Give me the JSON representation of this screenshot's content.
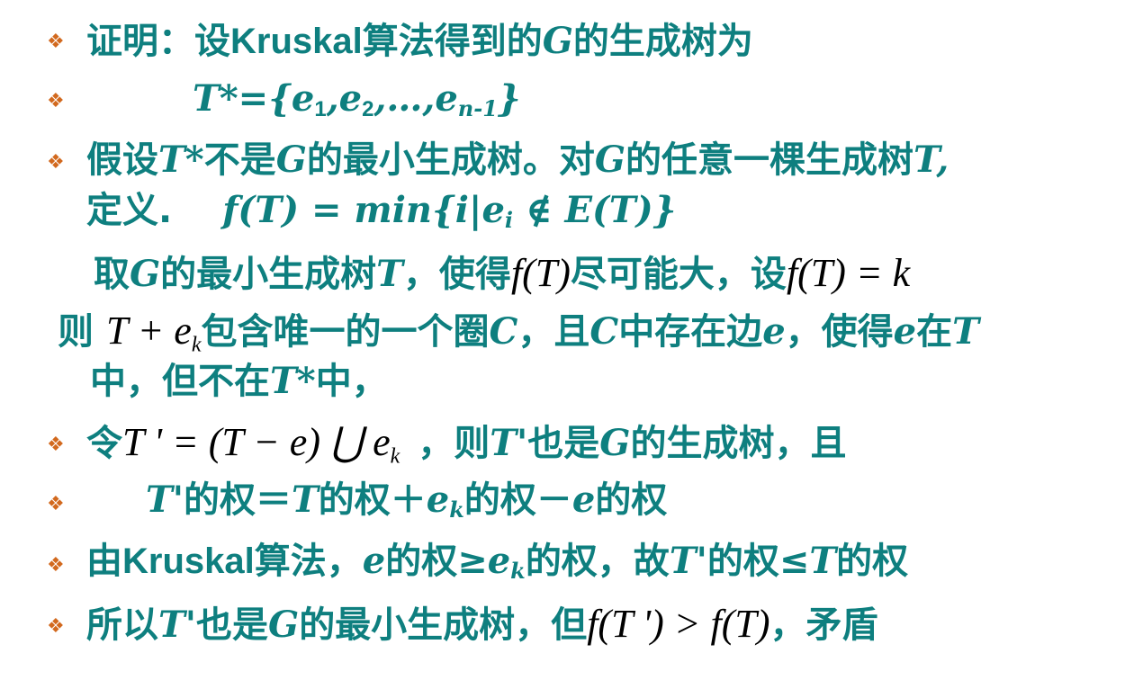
{
  "bullet_glyph": "❖",
  "colors": {
    "text": "#0e7f7f",
    "bullet": "#d2691e",
    "formula": "#000000"
  },
  "lines": {
    "l1": {
      "a": "证明：设",
      "b": "Kruskal",
      "c": "算法得到的",
      "d": "G",
      "e": "的生成树为"
    },
    "l2": {
      "a": "T*={",
      "b": "e",
      "b_sub": "1",
      "c": ",",
      "d": "e",
      "d_sub": "2",
      "e": ",…,",
      "f": "e",
      "f_sub": "n-1",
      "g": "}"
    },
    "l3": {
      "a": "假设",
      "b": "T*",
      "c": "不是",
      "d": "G",
      "e": "的最小生成树。对",
      "f": "G",
      "g": "的任意一棵生成树",
      "h": "T",
      "i": ","
    },
    "l4": {
      "a": "定义.",
      "b": "f(T) = min{i|e",
      "b_sub": "i",
      "c": " ∉ E(T)}"
    },
    "l5": {
      "a": "取",
      "b": "G",
      "c": "的最小生成树",
      "d": "T",
      "e": "，使得",
      "f": "f(T)",
      "g": "尽可能大，设",
      "h": "f(T) = k"
    },
    "l6": {
      "a": "则",
      "b": "T + e",
      "b_sub": "k",
      "c": "包含唯一的一个圈",
      "d": "C",
      "e": "，且",
      "f": "C",
      "g": "中存在边",
      "h": "e",
      "i": "，使得",
      "j": "e",
      "k": "在",
      "l": "T"
    },
    "l7": {
      "a": "中，但不在",
      "b": "T*",
      "c": "中，"
    },
    "l8": {
      "a": "令",
      "b": "T ' = (T − e) ⋃ e",
      "b_sub": "k",
      "c": "，则",
      "d": "T'",
      "e": "也是",
      "f": "G",
      "g": "的生成树，且"
    },
    "l9": {
      "a": "T'",
      "b": "的权＝",
      "c": "T",
      "d": "的权＋",
      "e": "e",
      "e_sub": "k",
      "f": "的权－",
      "g": "e",
      "h": "的权"
    },
    "l10": {
      "a": "由",
      "b": "Kruskal",
      "c": "算法，",
      "d": "e",
      "e": "的权≥",
      "f": "e",
      "f_sub": "k",
      "g": "的权，故",
      "h": "T'",
      "i": "的权≤",
      "j": "T",
      "k": "的权"
    },
    "l11": {
      "a": "所以",
      "b": "T'",
      "c": "也是",
      "d": "G",
      "e": "的最小生成树，但",
      "f": "f(T ') > f(T)",
      "g": "，矛盾"
    }
  }
}
